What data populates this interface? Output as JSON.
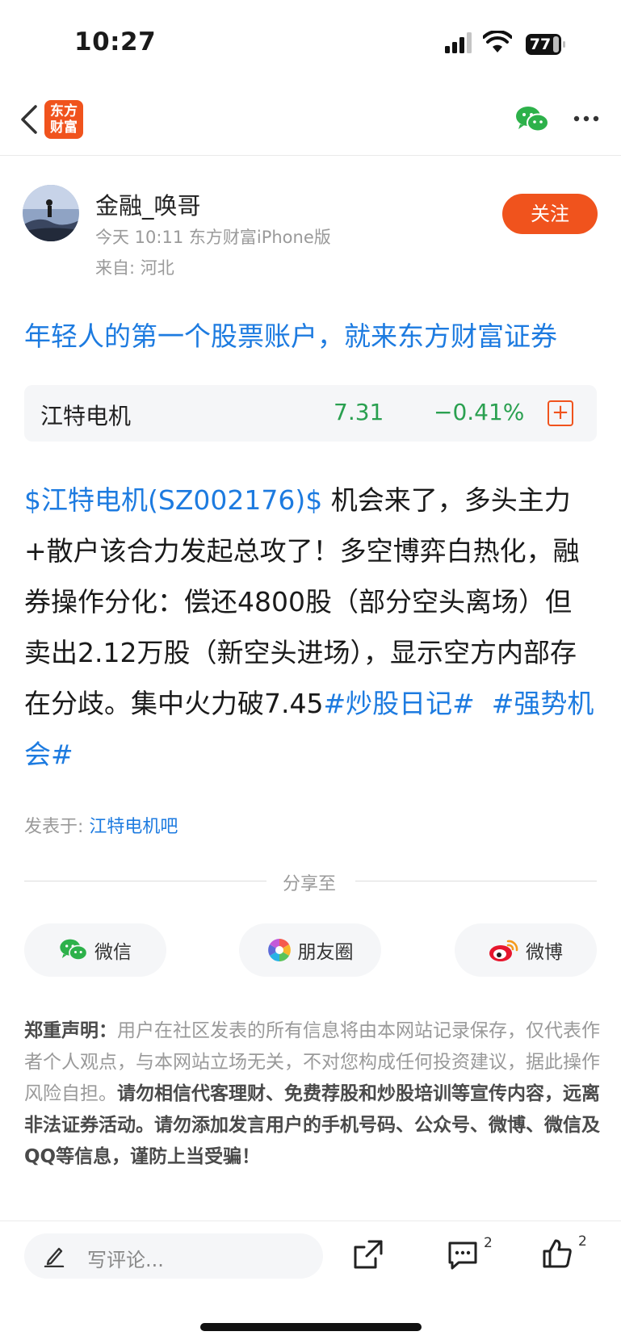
{
  "status_bar": {
    "time": "10:27",
    "battery": "77"
  },
  "nav": {
    "logo_line1": "东方",
    "logo_line2": "财富"
  },
  "author": {
    "name": "金融_唤哥",
    "meta": "今天 10:11 东方财富iPhone版",
    "location": "来自: 河北",
    "follow_label": "关注"
  },
  "promo": "年轻人的第一个股票账户，就来东方财富证券",
  "stock": {
    "name": "江特电机",
    "price": "7.31",
    "change": "−0.41%",
    "add_symbol": "+"
  },
  "post": {
    "stock_tag": "$江特电机(SZ002176)$",
    "body": "  机会来了，多头主力+散户该合力发起总攻了！多空博弈白热化，融券操作分化：偿还4800股（部分空头离场）但卖出2.12万股（新空头进场），显示空方内部存在分歧。集中火力破7.45",
    "topic1": "#炒股日记#",
    "topic2": "#强势机会#"
  },
  "posted_in": {
    "label": "发表于: ",
    "bar": "江特电机吧"
  },
  "share": {
    "label": "分享至",
    "wechat": "微信",
    "moments": "朋友圈",
    "weibo": "微博"
  },
  "disclaimer": {
    "title": "郑重声明：",
    "normal": "用户在社区发表的所有信息将由本网站记录保存，仅代表作者个人观点，与本网站立场无关，不对您构成任何投资建议，据此操作风险自担。",
    "bold": "请勿相信代客理财、免费荐股和炒股培训等宣传内容，远离非法证券活动。请勿添加发言用户的手机号码、公众号、微博、微信及QQ等信息，谨防上当受骗！"
  },
  "bottom_bar": {
    "comment_placeholder": "写评论...",
    "comment_count": "2",
    "like_count": "2"
  },
  "colors": {
    "brand": "#f0531d",
    "link": "#1d7be0",
    "down": "#2aa050"
  },
  "icons": [
    "back-icon",
    "wechat-icon",
    "more-icon",
    "plus-icon",
    "moments-icon",
    "weibo-icon",
    "pen-icon",
    "share-icon",
    "comment-icon",
    "like-icon"
  ]
}
